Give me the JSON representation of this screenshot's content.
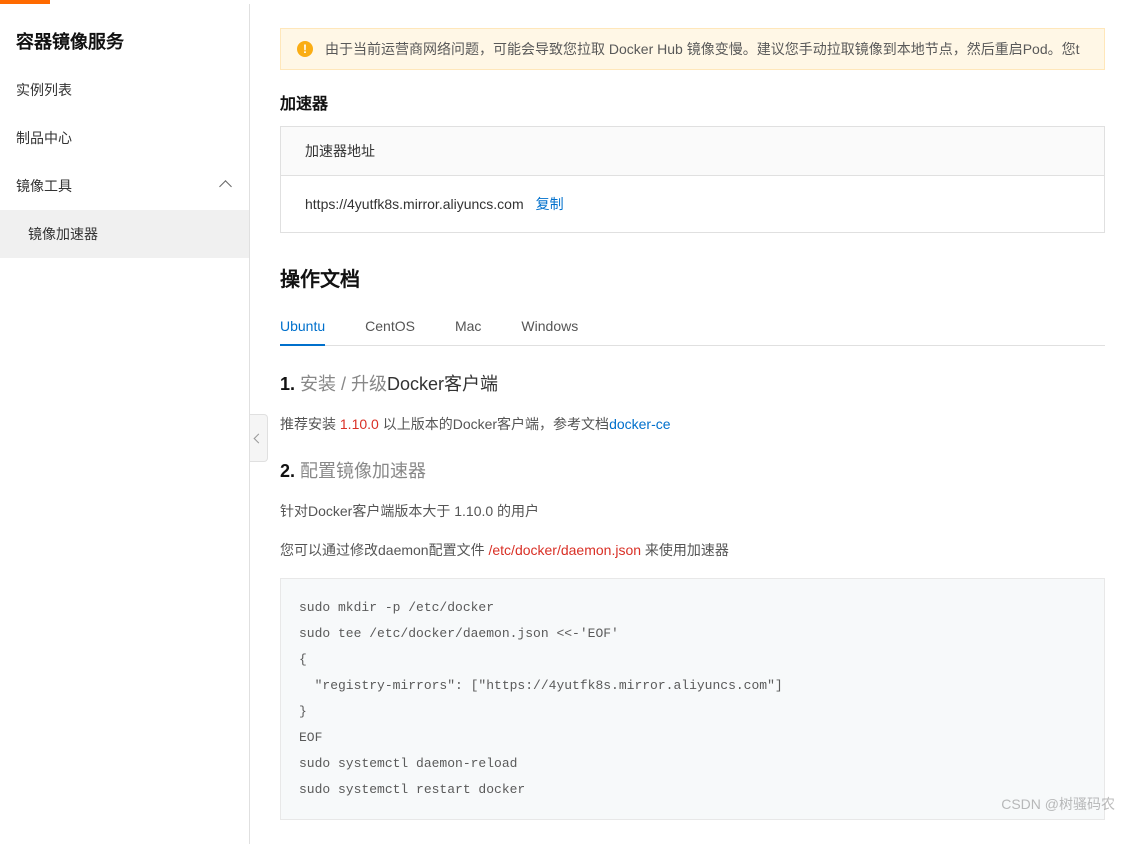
{
  "sidebar": {
    "title": "容器镜像服务",
    "items": [
      {
        "label": "实例列表"
      },
      {
        "label": "制品中心"
      },
      {
        "label": "镜像工具",
        "expanded": true
      }
    ],
    "subitem": "镜像加速器"
  },
  "alert": {
    "text": "由于当前运营商网络问题，可能会导致您拉取 Docker Hub 镜像变慢。建议您手动拉取镜像到本地节点，然后重启Pod。您t"
  },
  "accelerator": {
    "section_title": "加速器",
    "header": "加速器地址",
    "url": "https://4yutfk8s.mirror.aliyuncs.com",
    "copy": "复制"
  },
  "docs": {
    "title": "操作文档",
    "tabs": [
      "Ubuntu",
      "CentOS",
      "Mac",
      "Windows"
    ],
    "step1": {
      "num": "1.",
      "light": " 安装 / 升级",
      "bold": "Docker客户端",
      "text_pre": "推荐安装 ",
      "version": "1.10.0",
      "text_mid": " 以上版本的Docker客户端，参考文档",
      "link": "docker-ce"
    },
    "step2": {
      "num": "2.",
      "light": " 配置镜像加速器",
      "para1": "针对Docker客户端版本大于 1.10.0 的用户",
      "para2_pre": "您可以通过修改daemon配置文件 ",
      "para2_path": "/etc/docker/daemon.json",
      "para2_post": " 来使用加速器"
    },
    "code": "sudo mkdir -p /etc/docker\nsudo tee /etc/docker/daemon.json <<-'EOF'\n{\n  \"registry-mirrors\": [\"https://4yutfk8s.mirror.aliyuncs.com\"]\n}\nEOF\nsudo systemctl daemon-reload\nsudo systemctl restart docker"
  },
  "watermark": "CSDN @树骚码农"
}
